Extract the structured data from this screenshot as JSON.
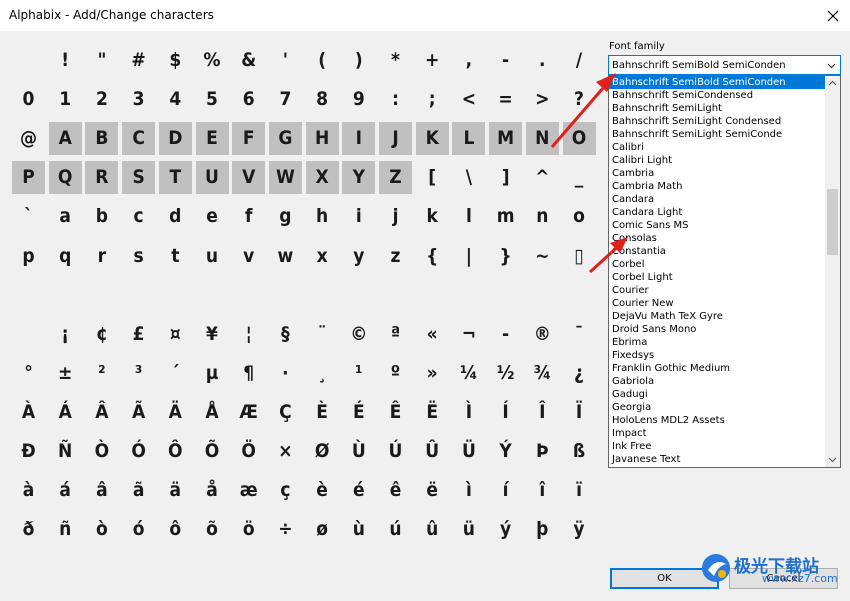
{
  "window": {
    "title": "Alphabix - Add/Change characters",
    "close_icon": "close-icon"
  },
  "characters": {
    "rows": [
      [
        "",
        "!",
        "\"",
        "#",
        "$",
        "%",
        "&",
        "'",
        "(",
        ")",
        "*",
        "+",
        ",",
        "-",
        ".",
        "/"
      ],
      [
        "0",
        "1",
        "2",
        "3",
        "4",
        "5",
        "6",
        "7",
        "8",
        "9",
        ":",
        ";",
        "<",
        "=",
        ">",
        "?"
      ],
      [
        "@",
        "A",
        "B",
        "C",
        "D",
        "E",
        "F",
        "G",
        "H",
        "I",
        "J",
        "K",
        "L",
        "M",
        "N",
        "O"
      ],
      [
        "P",
        "Q",
        "R",
        "S",
        "T",
        "U",
        "V",
        "W",
        "X",
        "Y",
        "Z",
        "[",
        "\\",
        "]",
        "^",
        "_"
      ],
      [
        "`",
        "a",
        "b",
        "c",
        "d",
        "e",
        "f",
        "g",
        "h",
        "i",
        "j",
        "k",
        "l",
        "m",
        "n",
        "o"
      ],
      [
        "p",
        "q",
        "r",
        "s",
        "t",
        "u",
        "v",
        "w",
        "x",
        "y",
        "z",
        "{",
        "|",
        "}",
        "~",
        "▯"
      ],
      [
        "",
        "",
        "",
        "",
        "",
        "",
        "",
        "",
        "",
        "",
        "",
        "",
        "",
        "",
        "",
        ""
      ],
      [
        "",
        "¡",
        "¢",
        "£",
        "¤",
        "¥",
        "¦",
        "§",
        "¨",
        "©",
        "ª",
        "«",
        "¬",
        "-",
        "®",
        "¯"
      ],
      [
        "°",
        "±",
        "²",
        "³",
        "´",
        "µ",
        "¶",
        "·",
        "¸",
        "¹",
        "º",
        "»",
        "¼",
        "½",
        "¾",
        "¿"
      ],
      [
        "À",
        "Á",
        "Â",
        "Ã",
        "Ä",
        "Å",
        "Æ",
        "Ç",
        "È",
        "É",
        "Ê",
        "Ë",
        "Ì",
        "Í",
        "Î",
        "Ï"
      ],
      [
        "Ð",
        "Ñ",
        "Ò",
        "Ó",
        "Ô",
        "Õ",
        "Ö",
        "×",
        "Ø",
        "Ù",
        "Ú",
        "Û",
        "Ü",
        "Ý",
        "Þ",
        "ß"
      ],
      [
        "à",
        "á",
        "â",
        "ã",
        "ä",
        "å",
        "æ",
        "ç",
        "è",
        "é",
        "ê",
        "ë",
        "ì",
        "í",
        "î",
        "ï"
      ],
      [
        "ð",
        "ñ",
        "ò",
        "ó",
        "ô",
        "õ",
        "ö",
        "÷",
        "ø",
        "ù",
        "ú",
        "û",
        "ü",
        "ý",
        "þ",
        "ÿ"
      ]
    ],
    "selected": [
      "A",
      "B",
      "C",
      "D",
      "E",
      "F",
      "G",
      "H",
      "I",
      "J",
      "K",
      "L",
      "M",
      "N",
      "O",
      "P",
      "Q",
      "R",
      "S",
      "T",
      "U",
      "V",
      "W",
      "X",
      "Y",
      "Z"
    ],
    "selected_color": "#c0c0c0"
  },
  "font_family": {
    "label": "Font family",
    "selected": "Bahnschrift SemiBold SemiConden",
    "highlight_color": "#0078d7",
    "options": [
      "Bahnschrift SemiBold SemiConden",
      "Bahnschrift SemiCondensed",
      "Bahnschrift SemiLight",
      "Bahnschrift SemiLight Condensed",
      "Bahnschrift SemiLight SemiConde",
      "Calibri",
      "Calibri Light",
      "Cambria",
      "Cambria Math",
      "Candara",
      "Candara Light",
      "Comic Sans MS",
      "Consolas",
      "Constantia",
      "Corbel",
      "Corbel Light",
      "Courier",
      "Courier New",
      "DejaVu Math TeX Gyre",
      "Droid Sans Mono",
      "Ebrima",
      "Fixedsys",
      "Franklin Gothic Medium",
      "Gabriola",
      "Gadugi",
      "Georgia",
      "HoloLens MDL2 Assets",
      "Impact",
      "Ink Free",
      "Javanese Text"
    ]
  },
  "buttons": {
    "ok": "OK",
    "cancel": "Cancel"
  },
  "watermark": {
    "text": "极光下载站",
    "url": "www.xz7.com"
  },
  "annotation_color": "#e0201b"
}
